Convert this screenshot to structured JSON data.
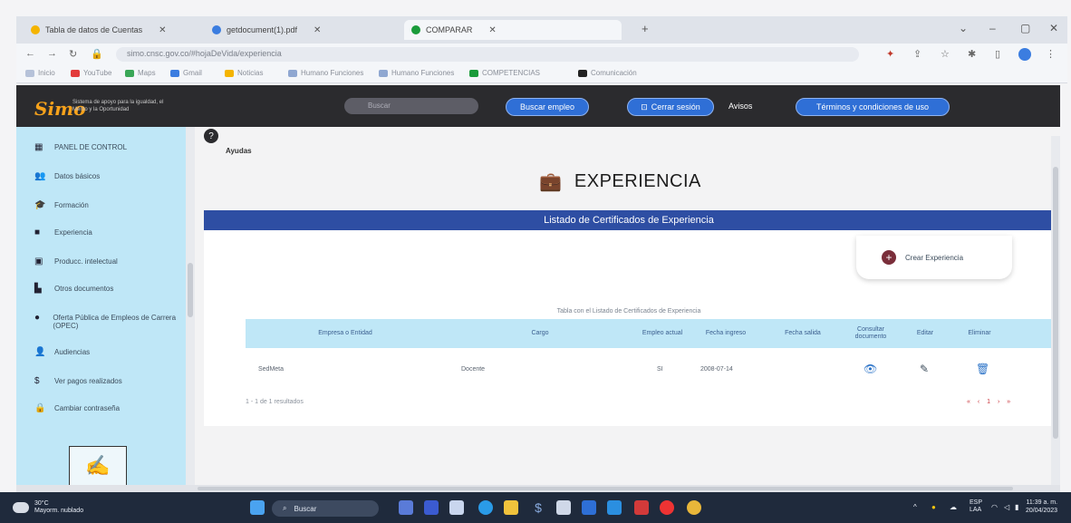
{
  "browser": {
    "tabs": [
      {
        "title": "Tabla de datos de Cuentas",
        "color": "#f4b400"
      },
      {
        "title": "getdocument(1).pdf",
        "color": "#3b7de0"
      },
      {
        "title": "COMPARAR",
        "color": "#1a9b3a"
      }
    ],
    "new_tab": "+",
    "url": "simo.cnsc.gov.co/#hojaDeVida/experiencia",
    "bookmarks": [
      "Inicio",
      "YouTube",
      "Maps",
      "Gmail",
      "Noticias",
      "Humano Funciones",
      "Humano Funciones",
      "COMPETENCIAS",
      "Comunicación"
    ]
  },
  "site": {
    "logo": "Simo",
    "logo_sub": "Sistema de apoyo para la igualdad, el Mérito y la Oportunidad",
    "search_placeholder": "Buscar",
    "buttons": {
      "find_job": "Buscar empleo",
      "logout": "Cerrar sesión",
      "terms": "Términos y condiciones de uso"
    },
    "notices": "Avisos"
  },
  "sidebar": {
    "items": [
      {
        "label": "PANEL DE CONTROL",
        "icon": "dashboard-icon"
      },
      {
        "label": "Datos básicos",
        "icon": "people-icon"
      },
      {
        "label": "Formación",
        "icon": "graduation-icon"
      },
      {
        "label": "Experiencia",
        "icon": "briefcase-icon"
      },
      {
        "label": "Producc. intelectual",
        "icon": "book-icon"
      },
      {
        "label": "Otros documentos",
        "icon": "document-icon"
      },
      {
        "label": "Oferta Pública de Empleos de Carrera (OPEC)",
        "icon": "globe-icon"
      },
      {
        "label": "Audiencias",
        "icon": "group-icon"
      },
      {
        "label": "Ver pagos realizados",
        "icon": "dollar-icon"
      },
      {
        "label": "Cambiar contraseña",
        "icon": "lock-icon"
      }
    ]
  },
  "main": {
    "help_label": "Ayudas",
    "title": "EXPERIENCIA",
    "banner": "Listado de Certificados de Experiencia",
    "create_button": "Crear Experiencia",
    "table_caption": "Tabla con el Listado de Certificados de Experiencia",
    "columns": [
      "Empresa o Entidad",
      "Cargo",
      "Empleo actual",
      "Fecha ingreso",
      "Fecha salida",
      "Consultar documento",
      "Editar",
      "Eliminar"
    ],
    "rows": [
      {
        "empresa": "SedMeta",
        "cargo": "Docente",
        "actual": "SI",
        "ingreso": "2008-07-14",
        "salida": ""
      }
    ],
    "results": "1 - 1 de 1 resultados",
    "pager": "« ‹ 1 › »"
  },
  "taskbar": {
    "weather_temp": "30°C",
    "weather_desc": "Mayorm. nublado",
    "search": "Buscar",
    "lang_line1": "ESP",
    "lang_line2": "LAA",
    "time": "11:39 a. m.",
    "date": "20/04/2023"
  }
}
